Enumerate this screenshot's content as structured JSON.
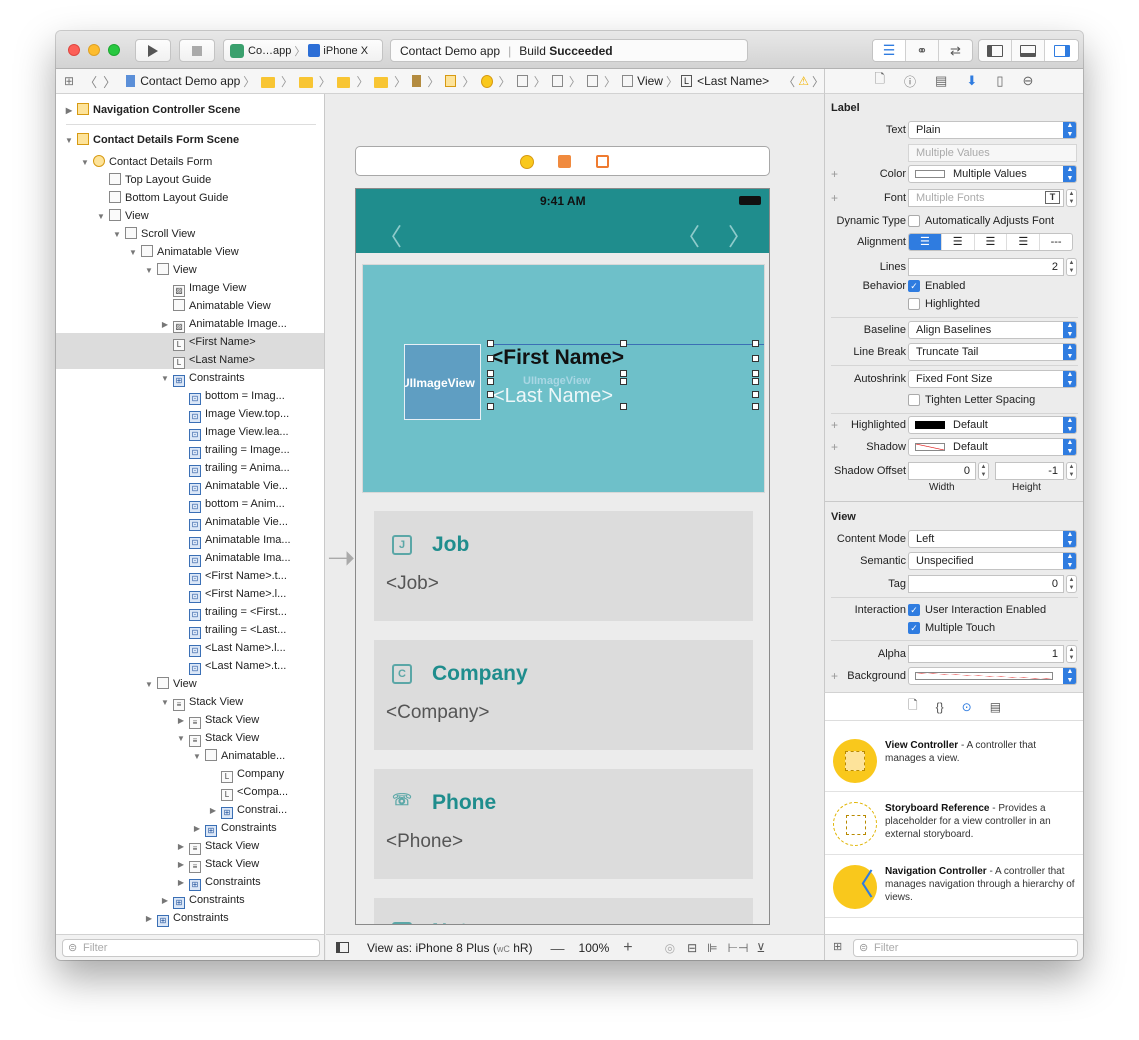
{
  "toolbar": {
    "scheme_app": "Co…app",
    "scheme_device": "iPhone X",
    "activity_app": "Contact Demo app",
    "activity_build": "Build",
    "activity_status": "Succeeded"
  },
  "jumpbar": {
    "project": "Contact Demo app",
    "view": "View",
    "label": "<Last Name>"
  },
  "navigator": {
    "rows": [
      {
        "text": "Navigation Controller Scene",
        "level": 0,
        "tri": "▶",
        "icon": "scene-icon",
        "bold": true
      },
      {
        "text": "Contact Details Form Scene",
        "level": 0,
        "tri": "▼",
        "icon": "scene-icon",
        "bold": true
      },
      {
        "text": "Contact Details Form",
        "level": 1,
        "tri": "▼",
        "icon": "controller-icon"
      },
      {
        "text": "Top Layout Guide",
        "level": 2,
        "tri": "",
        "icon": "guide-icon"
      },
      {
        "text": "Bottom Layout Guide",
        "level": 2,
        "tri": "",
        "icon": "guide-icon"
      },
      {
        "text": "View",
        "level": 2,
        "tri": "▼",
        "icon": "view-icon"
      },
      {
        "text": "Scroll View",
        "level": 3,
        "tri": "▼",
        "icon": "view-icon"
      },
      {
        "text": "Animatable View",
        "level": 4,
        "tri": "▼",
        "icon": "view-icon"
      },
      {
        "text": "View",
        "level": 5,
        "tri": "▼",
        "icon": "view-icon"
      },
      {
        "text": "Image View",
        "level": 6,
        "tri": "",
        "icon": "image-icon"
      },
      {
        "text": "Animatable View",
        "level": 6,
        "tri": "",
        "icon": "view-icon"
      },
      {
        "text": "Animatable Image...",
        "level": 6,
        "tri": "▶",
        "icon": "image-icon"
      },
      {
        "text": "<First Name>",
        "level": 6,
        "tri": "",
        "icon": "label-icon",
        "selected": true
      },
      {
        "text": "<Last Name>",
        "level": 6,
        "tri": "",
        "icon": "label-icon",
        "selected": true
      },
      {
        "text": "Constraints",
        "level": 6,
        "tri": "▼",
        "icon": "constraints-icon"
      },
      {
        "text": "bottom = Imag...",
        "level": 7,
        "tri": "",
        "icon": "constraint-icon"
      },
      {
        "text": "Image View.top...",
        "level": 7,
        "tri": "",
        "icon": "constraint-icon"
      },
      {
        "text": "Image View.lea...",
        "level": 7,
        "tri": "",
        "icon": "constraint-icon"
      },
      {
        "text": "trailing = Image...",
        "level": 7,
        "tri": "",
        "icon": "constraint-icon"
      },
      {
        "text": "trailing = Anima...",
        "level": 7,
        "tri": "",
        "icon": "constraint-icon"
      },
      {
        "text": "Animatable Vie...",
        "level": 7,
        "tri": "",
        "icon": "constraint-icon"
      },
      {
        "text": "bottom = Anim...",
        "level": 7,
        "tri": "",
        "icon": "constraint-icon"
      },
      {
        "text": "Animatable Vie...",
        "level": 7,
        "tri": "",
        "icon": "constraint-icon"
      },
      {
        "text": "Animatable Ima...",
        "level": 7,
        "tri": "",
        "icon": "constraint-icon"
      },
      {
        "text": "Animatable Ima...",
        "level": 7,
        "tri": "",
        "icon": "constraint-icon"
      },
      {
        "text": "<First Name>.t...",
        "level": 7,
        "tri": "",
        "icon": "constraint-icon"
      },
      {
        "text": "<First Name>.l...",
        "level": 7,
        "tri": "",
        "icon": "constraint-icon"
      },
      {
        "text": "trailing = <First...",
        "level": 7,
        "tri": "",
        "icon": "constraint-icon"
      },
      {
        "text": "trailing = <Last...",
        "level": 7,
        "tri": "",
        "icon": "constraint-icon"
      },
      {
        "text": "<Last Name>.l...",
        "level": 7,
        "tri": "",
        "icon": "constraint-icon"
      },
      {
        "text": "<Last Name>.t...",
        "level": 7,
        "tri": "",
        "icon": "constraint-icon"
      },
      {
        "text": "View",
        "level": 5,
        "tri": "▼",
        "icon": "view-icon"
      },
      {
        "text": "Stack View",
        "level": 6,
        "tri": "▼",
        "icon": "stack-icon"
      },
      {
        "text": "Stack View",
        "level": 7,
        "tri": "▶",
        "icon": "stack-icon"
      },
      {
        "text": "Stack View",
        "level": 7,
        "tri": "▼",
        "icon": "stack-icon"
      },
      {
        "text": "Animatable...",
        "level": 8,
        "tri": "▼",
        "icon": "view-icon"
      },
      {
        "text": "Company",
        "level": 9,
        "tri": "",
        "icon": "label-icon"
      },
      {
        "text": "<Compa...",
        "level": 9,
        "tri": "",
        "icon": "label-icon"
      },
      {
        "text": "Constrai...",
        "level": 9,
        "tri": "▶",
        "icon": "constraints-icon"
      },
      {
        "text": "Constraints",
        "level": 8,
        "tri": "▶",
        "icon": "constraints-icon"
      },
      {
        "text": "Stack View",
        "level": 7,
        "tri": "▶",
        "icon": "stack-icon"
      },
      {
        "text": "Stack View",
        "level": 7,
        "tri": "▶",
        "icon": "stack-icon"
      },
      {
        "text": "Constraints",
        "level": 7,
        "tri": "▶",
        "icon": "constraints-icon"
      },
      {
        "text": "Constraints",
        "level": 6,
        "tri": "▶",
        "icon": "constraints-icon"
      },
      {
        "text": "Constraints",
        "level": 5,
        "tri": "▶",
        "icon": "constraints-icon"
      }
    ],
    "filter_placeholder": "Filter"
  },
  "canvas": {
    "time": "9:41 AM",
    "first_name": "<First Name>",
    "last_name": "<Last Name>",
    "image_view": "UIImageView",
    "cards": [
      {
        "icon": "J",
        "title": "Job",
        "value": "<Job>"
      },
      {
        "icon": "C",
        "title": "Company",
        "value": "<Company>"
      },
      {
        "icon": "☏",
        "title": "Phone",
        "value": "<Phone>"
      },
      {
        "icon": "N",
        "title": "Notes",
        "value": ""
      }
    ],
    "view_as": "View as: iPhone 8 Plus (",
    "view_as_wc": "wC",
    "view_as_hr": "hR)",
    "zoom": "100%"
  },
  "inspector": {
    "label_header": "Label",
    "text_label": "Text",
    "text_value": "Plain",
    "multiple_values": "Multiple Values",
    "color_label": "Color",
    "color_value": "Multiple Values",
    "font_label": "Font",
    "font_value": "Multiple Fonts",
    "dynamic_type_label": "Dynamic Type",
    "dynamic_type_value": "Automatically Adjusts Font",
    "alignment_label": "Alignment",
    "lines_label": "Lines",
    "lines_value": "2",
    "behavior_label": "Behavior",
    "enabled": "Enabled",
    "highlighted": "Highlighted",
    "baseline_label": "Baseline",
    "baseline_value": "Align Baselines",
    "linebreak_label": "Line Break",
    "linebreak_value": "Truncate Tail",
    "autoshrink_label": "Autoshrink",
    "autoshrink_value": "Fixed Font Size",
    "tighten": "Tighten Letter Spacing",
    "highlighted_label": "Highlighted",
    "highlighted_value": "Default",
    "shadow_label": "Shadow",
    "shadow_value": "Default",
    "shadow_offset_label": "Shadow Offset",
    "shadow_width": "0",
    "shadow_height": "-1",
    "width_label": "Width",
    "height_label": "Height",
    "view_header": "View",
    "content_mode_label": "Content Mode",
    "content_mode_value": "Left",
    "semantic_label": "Semantic",
    "semantic_value": "Unspecified",
    "tag_label": "Tag",
    "tag_value": "0",
    "interaction_label": "Interaction",
    "user_interaction": "User Interaction Enabled",
    "multiple_touch": "Multiple Touch",
    "alpha_label": "Alpha",
    "alpha_value": "1",
    "background_label": "Background"
  },
  "library": {
    "items": [
      {
        "name": "View Controller",
        "desc": " - A controller that manages a view."
      },
      {
        "name": "Storyboard Reference",
        "desc": " - Provides a placeholder for a view controller in an external storyboard."
      },
      {
        "name": "Navigation Controller",
        "desc": " - A controller that manages navigation through a hierarchy of views."
      }
    ],
    "filter_placeholder": "Filter"
  },
  "colors": {
    "teal": "#1f8d8d",
    "header_blue": "#6ec0c9",
    "accent": "#2f7ce0",
    "library_yellow": "#f9c81c"
  }
}
